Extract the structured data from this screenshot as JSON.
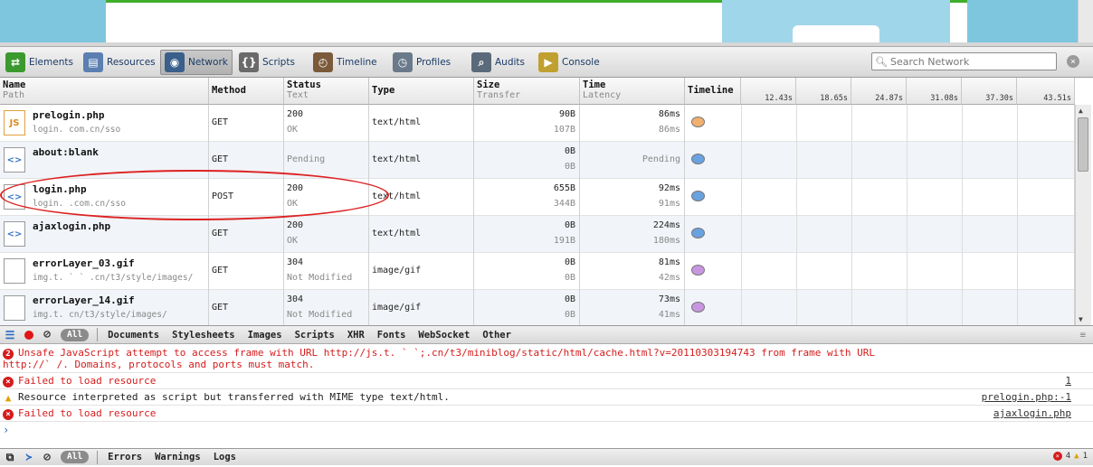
{
  "toolbar": {
    "tabs": [
      {
        "label": "Elements",
        "icon": "elements-icon"
      },
      {
        "label": "Resources",
        "icon": "resources-icon"
      },
      {
        "label": "Network",
        "icon": "network-icon"
      },
      {
        "label": "Scripts",
        "icon": "scripts-icon"
      },
      {
        "label": "Timeline",
        "icon": "timeline-icon"
      },
      {
        "label": "Profiles",
        "icon": "profiles-icon"
      },
      {
        "label": "Audits",
        "icon": "audits-icon"
      },
      {
        "label": "Console",
        "icon": "console-icon"
      }
    ],
    "active_tab": "Network",
    "search_placeholder": "Search Network"
  },
  "grid": {
    "columns": {
      "name": {
        "title": "Name",
        "sub": "Path"
      },
      "method": {
        "title": "Method"
      },
      "status": {
        "title": "Status",
        "sub": "Text"
      },
      "type": {
        "title": "Type"
      },
      "size": {
        "title": "Size",
        "sub": "Transfer"
      },
      "time": {
        "title": "Time",
        "sub": "Latency"
      },
      "timeline": {
        "title": "Timeline"
      }
    },
    "timeline_ticks": [
      "12.43s",
      "18.65s",
      "24.87s",
      "31.08s",
      "37.30s",
      "43.51s"
    ],
    "rows": [
      {
        "name": "prelogin.php",
        "path": "login.      com.cn/sso",
        "icon": "js-file-icon",
        "method": "GET",
        "status": "200",
        "status_text": "OK",
        "type": "text/html",
        "size": "90B",
        "transfer": "107B",
        "time": "86ms",
        "latency": "86ms",
        "dot_color": "#f0b070"
      },
      {
        "name": "about:blank",
        "path": "",
        "icon": "html-file-icon",
        "method": "GET",
        "status": "",
        "status_text": "Pending",
        "type": "text/html",
        "size": "0B",
        "transfer": "0B",
        "time": "",
        "latency": "Pending",
        "dot_color": "#6aa2e0"
      },
      {
        "name": "login.php",
        "path": "login.      .com.cn/sso",
        "icon": "html-file-icon",
        "method": "POST",
        "status": "200",
        "status_text": "OK",
        "type": "text/html",
        "size": "655B",
        "transfer": "344B",
        "time": "92ms",
        "latency": "91ms",
        "dot_color": "#6aa2e0"
      },
      {
        "name": "ajaxlogin.php",
        "path": "",
        "icon": "html-file-icon",
        "method": "GET",
        "status": "200",
        "status_text": "OK",
        "type": "text/html",
        "size": "0B",
        "transfer": "191B",
        "time": "224ms",
        "latency": "180ms",
        "dot_color": "#6aa2e0"
      },
      {
        "name": "errorLayer_03.gif",
        "path": "img.t.  ` `  .cn/t3/style/images/",
        "icon": "image-file-icon",
        "method": "GET",
        "status": "304",
        "status_text": "Not Modified",
        "type": "image/gif",
        "size": "0B",
        "transfer": "0B",
        "time": "81ms",
        "latency": "42ms",
        "dot_color": "#c896e0"
      },
      {
        "name": "errorLayer_14.gif",
        "path": "img.t.        cn/t3/style/images/",
        "icon": "image-file-icon",
        "method": "GET",
        "status": "304",
        "status_text": "Not Modified",
        "type": "image/gif",
        "size": "0B",
        "transfer": "0B",
        "time": "73ms",
        "latency": "41ms",
        "dot_color": "#c896e0"
      }
    ]
  },
  "filters": [
    "All",
    "Documents",
    "Stylesheets",
    "Images",
    "Scripts",
    "XHR",
    "Fonts",
    "WebSocket",
    "Other"
  ],
  "console": {
    "messages": [
      {
        "kind": "error",
        "count": "2",
        "text": "Unsafe JavaScript attempt to access frame with URL http://js.t.  `  `;.cn/t3/miniblog/static/html/cache.html?v=20110303194743 from frame with URL",
        "text2": "http://`        /. Domains, protocols and ports must match.",
        "source": ""
      },
      {
        "kind": "error",
        "count": "",
        "text": "Failed to load resource",
        "text2": "",
        "source": "1"
      },
      {
        "kind": "warning",
        "count": "",
        "text": "Resource interpreted as script but transferred with MIME type text/html.",
        "text2": "",
        "source": "prelogin.php:-1"
      },
      {
        "kind": "error",
        "count": "",
        "text": "Failed to load resource",
        "text2": "",
        "source": "ajaxlogin.php"
      }
    ],
    "prompt": "›"
  },
  "statusbar": {
    "filter_all": "All",
    "filters": [
      "Errors",
      "Warnings",
      "Logs"
    ],
    "error_count": "4",
    "warning_count": "1"
  },
  "colors": {
    "error": "#d51c1c",
    "accent": "#1a3a66",
    "annotation": "#d22222"
  }
}
